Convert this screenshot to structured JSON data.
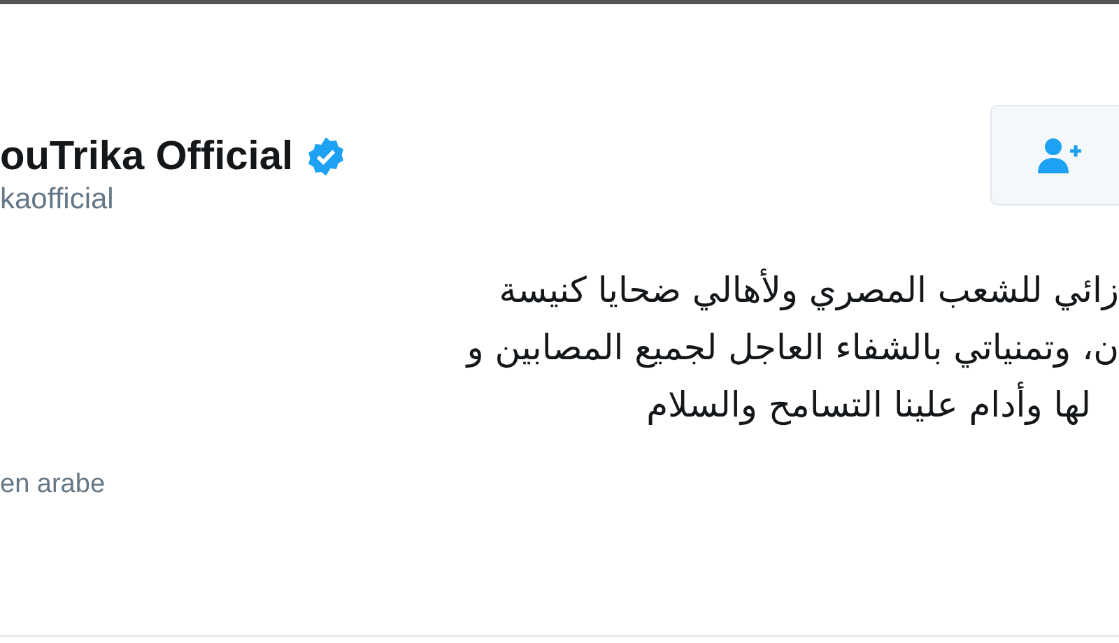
{
  "tweet": {
    "author_name": "ouTrika Official",
    "verified": true,
    "handle": "kaofficial",
    "follow_button": {
      "kind": "follow"
    },
    "text_lines": [
      "زائي للشعب المصري ولأهالي ضحايا كنيسة",
      "ن، وتمنياتي بالشفاء العاجل لجميع المصابين و",
      "لها وأدام علينا التسامح والسلام"
    ],
    "translate_link": "en arabe"
  }
}
